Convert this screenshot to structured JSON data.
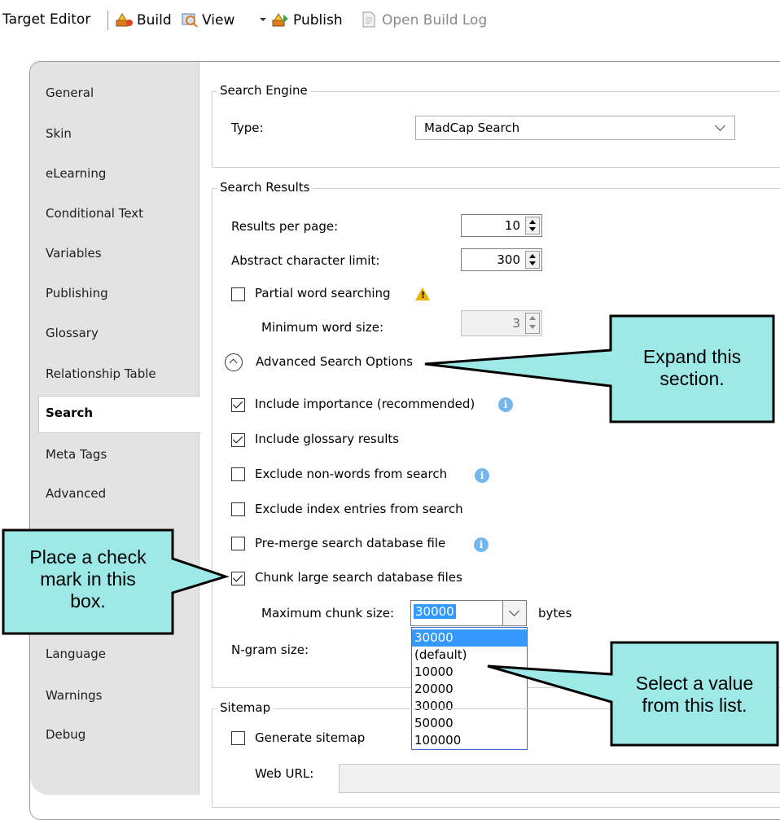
{
  "toolbar": {
    "title": "Target Editor",
    "build": "Build",
    "view": "View",
    "publish": "Publish",
    "open_build_log": "Open Build Log"
  },
  "sidebar": {
    "items": [
      "General",
      "Skin",
      "eLearning",
      "Conditional Text",
      "Variables",
      "Publishing",
      "Glossary",
      "Relationship Table",
      "Search",
      "Meta Tags",
      "Advanced",
      "Language",
      "Warnings",
      "Debug"
    ],
    "selected": "Search"
  },
  "search_engine": {
    "group_title": "Search Engine",
    "type_label": "Type:",
    "type_value": "MadCap Search"
  },
  "search_results": {
    "group_title": "Search Results",
    "results_per_page_label": "Results per page:",
    "results_per_page_value": "10",
    "abstract_limit_label": "Abstract character limit:",
    "abstract_limit_value": "300",
    "partial_word_label": "Partial word searching",
    "partial_word_checked": false,
    "min_word_size_label": "Minimum word size:",
    "min_word_size_value": "3",
    "advanced_options_label": "Advanced Search Options",
    "include_importance_label": "Include importance (recommended)",
    "include_importance_checked": true,
    "include_glossary_label": "Include glossary results",
    "include_glossary_checked": true,
    "exclude_nonwords_label": "Exclude non-words from search",
    "exclude_nonwords_checked": false,
    "exclude_index_label": "Exclude index entries from search",
    "exclude_index_checked": false,
    "premerge_label": "Pre-merge search database file",
    "premerge_checked": false,
    "chunk_label": "Chunk large search database files",
    "chunk_checked": true,
    "max_chunk_label": "Maximum chunk size:",
    "max_chunk_value": "30000",
    "bytes_label": "bytes",
    "ngram_label": "N-gram size:",
    "chunk_options": [
      "30000",
      "(default)",
      "10000",
      "20000",
      "30000",
      "50000",
      "100000"
    ],
    "chunk_selected_index": 0
  },
  "sitemap": {
    "group_title": "Sitemap",
    "generate_label": "Generate sitemap",
    "generate_checked": false,
    "web_url_label": "Web URL:"
  },
  "callouts": {
    "expand": [
      "Expand this",
      "section."
    ],
    "checkmark": [
      "Place a check",
      "mark in this",
      "box."
    ],
    "select": [
      "Select a value",
      "from this list."
    ]
  },
  "colors": {
    "callout_fill": "#9de9e8",
    "callout_border": "#000000",
    "selection_blue": "#3399ff",
    "sidebar_bg": "#e3e3e3"
  }
}
